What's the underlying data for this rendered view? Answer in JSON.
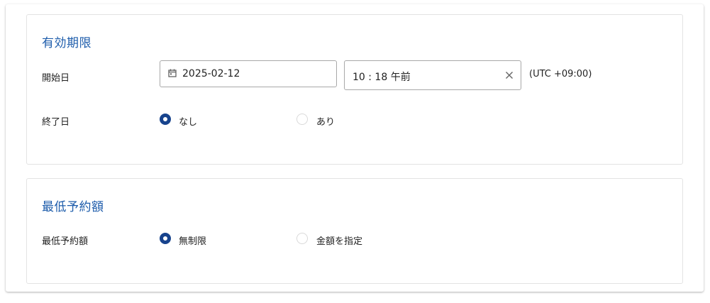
{
  "validity": {
    "title": "有効期限",
    "start_label": "開始日",
    "start_date": "2025-02-12",
    "start_time": "10 : 18 午前",
    "timezone": "(UTC +09:00)",
    "end_label": "終了日",
    "end_options": [
      {
        "label": "なし",
        "selected": true
      },
      {
        "label": "あり",
        "selected": false
      }
    ]
  },
  "min_amount": {
    "title": "最低予約額",
    "label": "最低予約額",
    "options": [
      {
        "label": "無制限",
        "selected": true
      },
      {
        "label": "金額を指定",
        "selected": false
      }
    ]
  },
  "icons": {
    "calendar": "calendar-icon",
    "clear": "close-icon"
  },
  "colors": {
    "section_title": "#1d5cab",
    "radio_selected": "#17438d"
  }
}
